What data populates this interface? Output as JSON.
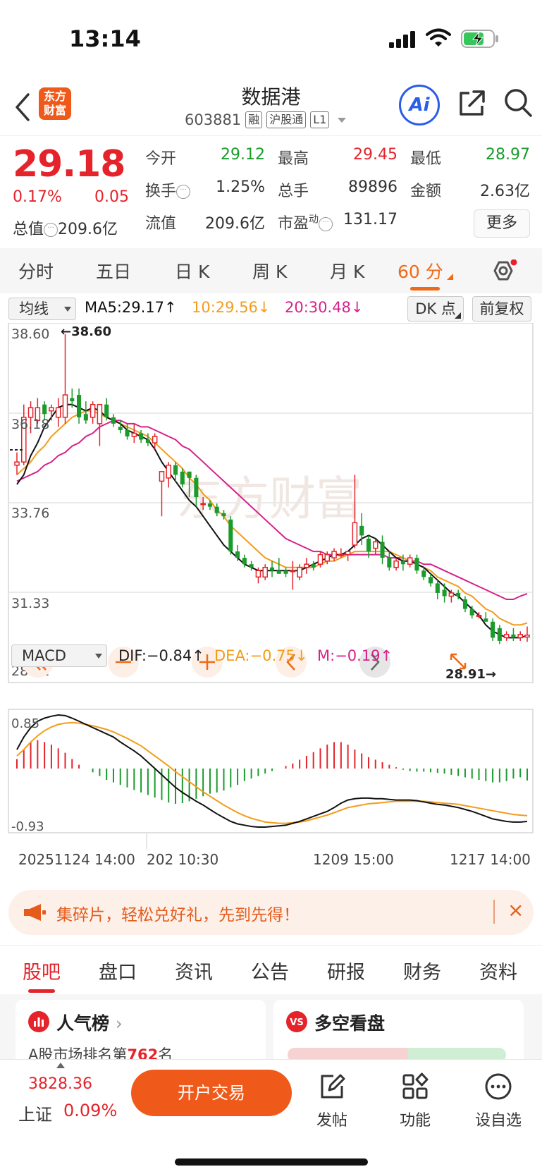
{
  "status_bar": {
    "time": "13:14"
  },
  "header": {
    "logo_text": "东方\n财富",
    "title": "数据港",
    "code": "603881",
    "tags": [
      "融",
      "沪股通",
      "L1"
    ],
    "ai_label": "Ai"
  },
  "quote": {
    "price": "29.18",
    "change_pct": "0.17%",
    "change": "0.05",
    "total_value_label": "总值",
    "total_value": "209.6亿",
    "stats": [
      {
        "label": "今开",
        "value": "29.12",
        "color": "green"
      },
      {
        "label": "最高",
        "value": "29.45",
        "color": "red"
      },
      {
        "label": "最低",
        "value": "28.97",
        "color": "green"
      },
      {
        "label": "换手",
        "value": "1.25%",
        "color": "dark"
      },
      {
        "label": "总手",
        "value": "89896",
        "color": "dark"
      },
      {
        "label": "金额",
        "value": "2.63亿",
        "color": "dark"
      },
      {
        "label": "流值",
        "value": "209.6亿",
        "color": "dark"
      },
      {
        "label": "市盈",
        "value": "131.17",
        "color": "dark"
      }
    ],
    "pe_sup": "动",
    "more_label": "更多"
  },
  "chart_tabs": [
    "分时",
    "五日",
    "日 K",
    "周 K",
    "月 K",
    "60 分"
  ],
  "active_chart_tab": "60 分",
  "ma_bar": {
    "type_label": "均线",
    "ma5": "MA5:29.17↑",
    "ma10": "10:29.56↓",
    "ma20": "20:30.48↓",
    "dk_label": "DK 点",
    "adjust_label": "前复权"
  },
  "macd_bar": {
    "type_label": "MACD",
    "dif": "DIF:−0.84↑",
    "dea": "DEA:−0.75↓",
    "m": "M:−0.19↑"
  },
  "colors": {
    "up": "#e5232b",
    "down": "#1a9b2c",
    "ma5": "#111111",
    "ma10": "#f39c1a",
    "ma20": "#d6218a",
    "accent": "#ef6a17"
  },
  "chart_data": {
    "type": "candlestick",
    "price_axis_labels": [
      "38.60",
      "36.18",
      "33.76",
      "31.33",
      "28.91"
    ],
    "ylim": [
      28.91,
      38.6
    ],
    "max_label": "←38.60",
    "min_label": "28.91→",
    "time_labels": [
      "20251124 14:00",
      "202 10:30",
      "1209 15:00",
      "1217 14:00"
    ],
    "candles": [
      [
        34.5,
        34.9,
        34.2,
        34.6
      ],
      [
        34.6,
        36.4,
        34.5,
        36.0
      ],
      [
        36.0,
        36.5,
        35.5,
        36.3
      ],
      [
        35.9,
        36.6,
        35.8,
        36.3
      ],
      [
        36.4,
        36.5,
        35.9,
        36.1
      ],
      [
        36.2,
        36.4,
        35.9,
        36.3
      ],
      [
        36.0,
        36.6,
        35.7,
        36.3
      ],
      [
        36.0,
        38.6,
        35.8,
        36.7
      ],
      [
        36.6,
        36.9,
        36.3,
        36.5
      ],
      [
        36.7,
        36.9,
        35.8,
        36.0
      ],
      [
        36.1,
        36.5,
        35.8,
        35.9
      ],
      [
        36.0,
        36.5,
        35.8,
        36.4
      ],
      [
        35.8,
        36.4,
        35.1,
        36.4
      ],
      [
        36.4,
        36.6,
        35.9,
        36.0
      ],
      [
        36.0,
        36.1,
        35.7,
        35.8
      ],
      [
        35.7,
        35.9,
        35.5,
        35.6
      ],
      [
        35.6,
        35.8,
        35.3,
        35.4
      ],
      [
        35.4,
        35.8,
        35.2,
        35.5
      ],
      [
        35.5,
        35.6,
        35.2,
        35.3
      ],
      [
        35.3,
        35.5,
        35.1,
        35.2
      ],
      [
        35.2,
        35.5,
        35.0,
        35.4
      ],
      [
        34.0,
        34.3,
        32.9,
        34.3
      ],
      [
        34.1,
        34.6,
        33.8,
        34.5
      ],
      [
        34.5,
        34.6,
        34.0,
        34.2
      ],
      [
        34.3,
        34.4,
        33.8,
        33.9
      ],
      [
        34.3,
        34.3,
        33.5,
        34.1
      ],
      [
        34.1,
        34.2,
        33.2,
        33.5
      ],
      [
        33.3,
        33.5,
        33.1,
        33.3
      ],
      [
        33.3,
        33.4,
        33.1,
        33.2
      ],
      [
        33.2,
        33.3,
        32.9,
        33.0
      ],
      [
        33.0,
        33.1,
        32.8,
        32.9
      ],
      [
        32.8,
        32.9,
        31.7,
        31.8
      ],
      [
        31.8,
        32.0,
        31.5,
        31.6
      ],
      [
        31.6,
        31.7,
        31.3,
        31.4
      ],
      [
        31.4,
        31.5,
        31.2,
        31.3
      ],
      [
        31.0,
        31.3,
        30.8,
        31.2
      ],
      [
        31.0,
        31.4,
        30.9,
        31.3
      ],
      [
        31.3,
        31.5,
        31.0,
        31.2
      ],
      [
        31.2,
        31.6,
        31.1,
        31.1
      ],
      [
        31.2,
        31.3,
        31.0,
        31.1
      ],
      [
        31.2,
        31.5,
        30.6,
        31.2
      ],
      [
        31.0,
        31.4,
        30.9,
        31.3
      ],
      [
        31.3,
        31.6,
        31.1,
        31.4
      ],
      [
        31.4,
        31.5,
        31.2,
        31.3
      ],
      [
        31.4,
        31.8,
        31.3,
        31.7
      ],
      [
        31.5,
        31.8,
        31.4,
        31.7
      ],
      [
        31.6,
        31.9,
        31.5,
        31.8
      ],
      [
        31.7,
        31.9,
        31.6,
        31.7
      ],
      [
        31.7,
        31.8,
        31.5,
        31.8
      ],
      [
        32.0,
        34.2,
        31.9,
        32.7
      ],
      [
        32.6,
        33.0,
        32.0,
        32.3
      ],
      [
        32.2,
        32.3,
        31.6,
        31.8
      ],
      [
        31.9,
        32.2,
        31.7,
        32.1
      ],
      [
        32.1,
        32.3,
        31.4,
        31.6
      ],
      [
        31.6,
        31.8,
        31.2,
        31.3
      ],
      [
        31.3,
        31.6,
        31.2,
        31.5
      ],
      [
        31.5,
        31.7,
        31.2,
        31.4
      ],
      [
        31.4,
        31.7,
        31.3,
        31.6
      ],
      [
        31.6,
        31.7,
        31.1,
        31.2
      ],
      [
        31.2,
        31.3,
        30.9,
        31.0
      ],
      [
        31.0,
        31.1,
        30.7,
        30.8
      ],
      [
        30.8,
        30.9,
        30.3,
        30.5
      ],
      [
        30.6,
        30.8,
        30.2,
        30.4
      ],
      [
        30.4,
        30.6,
        30.2,
        30.5
      ],
      [
        30.5,
        30.6,
        30.3,
        30.4
      ],
      [
        30.3,
        30.4,
        29.9,
        30.0
      ],
      [
        30.0,
        30.1,
        29.7,
        29.8
      ],
      [
        29.8,
        29.9,
        29.7,
        29.8
      ],
      [
        29.7,
        29.9,
        29.6,
        29.6
      ],
      [
        29.6,
        29.7,
        29.0,
        29.1
      ],
      [
        29.4,
        29.5,
        28.9,
        29.0
      ],
      [
        29.1,
        29.3,
        29.0,
        29.2
      ],
      [
        29.2,
        29.4,
        29.0,
        29.1
      ],
      [
        29.1,
        29.3,
        29.0,
        29.2
      ],
      [
        29.12,
        29.45,
        28.97,
        29.18
      ]
    ],
    "ma5": [
      33.9,
      34.2,
      34.8,
      35.2,
      35.7,
      36.0,
      36.3,
      36.4,
      36.4,
      36.3,
      36.2,
      36.3,
      36.2,
      36.0,
      35.9,
      35.8,
      35.6,
      35.5,
      35.4,
      35.3,
      35.0,
      34.6,
      34.3,
      34.0,
      33.7,
      33.4,
      33.2,
      32.9,
      32.6,
      32.3,
      32.0,
      31.8,
      31.6,
      31.4,
      31.3,
      31.2,
      31.2,
      31.2,
      31.2,
      31.2,
      31.2,
      31.2,
      31.3,
      31.4,
      31.5,
      31.6,
      31.7,
      31.7,
      31.8,
      32.0,
      32.2,
      32.3,
      32.2,
      32.0,
      31.8,
      31.6,
      31.5,
      31.5,
      31.4,
      31.3,
      31.1,
      30.9,
      30.7,
      30.5,
      30.4,
      30.2,
      30.0,
      29.8,
      29.5,
      29.3,
      29.2,
      29.1,
      29.1,
      29.1,
      29.17
    ],
    "ma10": [
      34.2,
      34.4,
      34.6,
      34.9,
      35.1,
      35.4,
      35.6,
      35.8,
      36.0,
      36.1,
      36.2,
      36.2,
      36.1,
      36.0,
      35.9,
      35.8,
      35.7,
      35.6,
      35.5,
      35.4,
      35.2,
      35.0,
      34.8,
      34.6,
      34.4,
      34.1,
      33.9,
      33.6,
      33.4,
      33.1,
      32.9,
      32.6,
      32.4,
      32.2,
      32.0,
      31.8,
      31.6,
      31.5,
      31.4,
      31.3,
      31.3,
      31.3,
      31.3,
      31.3,
      31.4,
      31.5,
      31.5,
      31.6,
      31.7,
      31.8,
      31.8,
      31.8,
      31.8,
      31.8,
      31.8,
      31.7,
      31.6,
      31.5,
      31.4,
      31.3,
      31.2,
      31.0,
      30.9,
      30.8,
      30.7,
      30.5,
      30.4,
      30.2,
      30.0,
      29.9,
      29.7,
      29.6,
      29.5,
      29.5,
      29.56
    ],
    "ma20": [
      34.0,
      34.1,
      34.2,
      34.3,
      34.5,
      34.6,
      34.8,
      34.9,
      35.1,
      35.2,
      35.4,
      35.5,
      35.7,
      35.8,
      35.9,
      35.9,
      35.8,
      35.8,
      35.7,
      35.7,
      35.6,
      35.5,
      35.4,
      35.3,
      35.1,
      35.0,
      34.8,
      34.6,
      34.4,
      34.2,
      34.0,
      33.8,
      33.6,
      33.4,
      33.2,
      33.0,
      32.8,
      32.6,
      32.4,
      32.2,
      32.1,
      32.0,
      31.9,
      31.8,
      31.8,
      31.7,
      31.7,
      31.7,
      31.7,
      31.7,
      31.7,
      31.7,
      31.7,
      31.7,
      31.6,
      31.6,
      31.6,
      31.5,
      31.5,
      31.4,
      31.4,
      31.3,
      31.2,
      31.1,
      31.0,
      30.9,
      30.8,
      30.7,
      30.6,
      30.5,
      30.4,
      30.3,
      30.3,
      30.4,
      30.48
    ],
    "macd": {
      "axis_labels": [
        "0.85",
        "-0.93"
      ],
      "ylim": [
        -0.93,
        0.85
      ],
      "dif": [
        0.3,
        0.5,
        0.65,
        0.75,
        0.8,
        0.83,
        0.85,
        0.84,
        0.8,
        0.75,
        0.7,
        0.65,
        0.6,
        0.55,
        0.5,
        0.42,
        0.35,
        0.28,
        0.2,
        0.1,
        0.0,
        -0.1,
        -0.2,
        -0.3,
        -0.38,
        -0.45,
        -0.52,
        -0.58,
        -0.65,
        -0.72,
        -0.78,
        -0.84,
        -0.88,
        -0.9,
        -0.92,
        -0.93,
        -0.93,
        -0.92,
        -0.91,
        -0.9,
        -0.87,
        -0.84,
        -0.8,
        -0.76,
        -0.72,
        -0.68,
        -0.62,
        -0.55,
        -0.5,
        -0.48,
        -0.47,
        -0.47,
        -0.48,
        -0.48,
        -0.49,
        -0.5,
        -0.5,
        -0.5,
        -0.51,
        -0.53,
        -0.55,
        -0.57,
        -0.58,
        -0.6,
        -0.62,
        -0.65,
        -0.68,
        -0.72,
        -0.76,
        -0.8,
        -0.82,
        -0.84,
        -0.85,
        -0.85,
        -0.84
      ],
      "dea": [
        0.2,
        0.3,
        0.42,
        0.52,
        0.6,
        0.66,
        0.7,
        0.72,
        0.73,
        0.72,
        0.7,
        0.68,
        0.65,
        0.62,
        0.58,
        0.53,
        0.48,
        0.42,
        0.36,
        0.28,
        0.2,
        0.12,
        0.04,
        -0.05,
        -0.13,
        -0.21,
        -0.29,
        -0.37,
        -0.44,
        -0.51,
        -0.58,
        -0.64,
        -0.7,
        -0.75,
        -0.79,
        -0.82,
        -0.85,
        -0.86,
        -0.87,
        -0.87,
        -0.86,
        -0.85,
        -0.83,
        -0.8,
        -0.77,
        -0.74,
        -0.7,
        -0.66,
        -0.62,
        -0.6,
        -0.58,
        -0.56,
        -0.55,
        -0.54,
        -0.53,
        -0.52,
        -0.52,
        -0.52,
        -0.52,
        -0.52,
        -0.53,
        -0.54,
        -0.55,
        -0.56,
        -0.57,
        -0.59,
        -0.61,
        -0.63,
        -0.65,
        -0.67,
        -0.69,
        -0.71,
        -0.73,
        -0.74,
        -0.75
      ],
      "hist": [
        0.15,
        0.3,
        0.42,
        0.45,
        0.42,
        0.38,
        0.32,
        0.25,
        0.15,
        0.06,
        0.0,
        -0.06,
        -0.12,
        -0.18,
        -0.22,
        -0.26,
        -0.3,
        -0.34,
        -0.38,
        -0.42,
        -0.46,
        -0.5,
        -0.54,
        -0.56,
        -0.55,
        -0.52,
        -0.48,
        -0.44,
        -0.4,
        -0.38,
        -0.35,
        -0.3,
        -0.26,
        -0.2,
        -0.16,
        -0.12,
        -0.08,
        -0.04,
        0.0,
        0.04,
        0.08,
        0.14,
        0.2,
        0.26,
        0.32,
        0.38,
        0.42,
        0.42,
        0.38,
        0.3,
        0.24,
        0.18,
        0.14,
        0.1,
        0.06,
        0.02,
        -0.02,
        -0.04,
        -0.05,
        -0.05,
        -0.06,
        -0.07,
        -0.08,
        -0.1,
        -0.12,
        -0.14,
        -0.16,
        -0.18,
        -0.2,
        -0.22,
        -0.22,
        -0.2,
        -0.16,
        -0.14,
        -0.19
      ]
    }
  },
  "banner": {
    "text": "集碎片，轻松兑好礼，先到先得！",
    "close": "×"
  },
  "bottom_tabs": [
    "股吧",
    "盘口",
    "资讯",
    "公告",
    "研报",
    "财务",
    "资料"
  ],
  "active_bottom_tab": "股吧",
  "cards": [
    {
      "title": "人气榜",
      "desc": "A股市场排名第",
      "rank": "762",
      "suffix": "名"
    },
    {
      "title": "多空看盘"
    }
  ],
  "bottom_nav": {
    "index_value": "3828.36",
    "index_name": "上证",
    "index_pct": "0.09%",
    "trade_label": "开户交易",
    "items": [
      "发帖",
      "功能",
      "设自选"
    ]
  }
}
